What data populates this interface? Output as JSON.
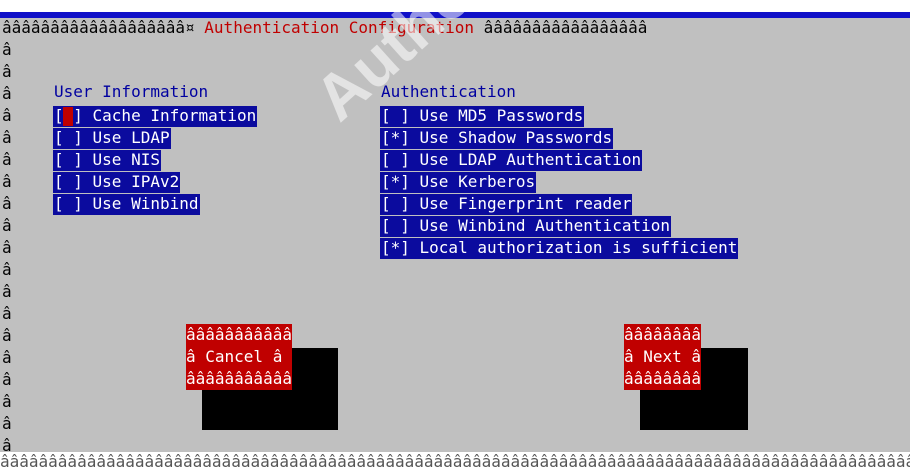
{
  "header": {
    "left_border": "âââââââââââââââââââ¤",
    "title": " Authentication Configuration ",
    "right_border": "âââââââââââââââââ"
  },
  "left_border_char": "â",
  "user_info": {
    "heading": "User Information",
    "items": [
      {
        "label": "[ ] Cache Information"
      },
      {
        "label": "[ ] Use LDAP"
      },
      {
        "label": "[ ] Use NIS"
      },
      {
        "label": "[ ] Use IPAv2"
      },
      {
        "label": "[ ] Use Winbind"
      }
    ]
  },
  "authentication": {
    "heading": "Authentication",
    "items": [
      {
        "label": "[ ] Use MD5 Passwords"
      },
      {
        "label": "[*] Use Shadow Passwords"
      },
      {
        "label": "[ ] Use LDAP Authentication"
      },
      {
        "label": "[*] Use Kerberos"
      },
      {
        "label": "[ ] Use Fingerprint reader"
      },
      {
        "label": "[ ] Use Winbind Authentication"
      },
      {
        "label": "[*] Local authorization is sufficient"
      }
    ]
  },
  "buttons": {
    "cancel": {
      "top": "âââââââââââ",
      "label": "â Cancel â",
      "bottom": "âââââââââââ"
    },
    "next": {
      "top": "ââââââââ",
      "label": "â Next â",
      "bottom": "ââââââââ"
    }
  },
  "bottom_border": "ââââââââââââââââââââââââââââââââââââââââââââââââââââââââââââââââââââââââââââââââââââââââââââââââââââââââââââ",
  "watermark": "Author retains"
}
